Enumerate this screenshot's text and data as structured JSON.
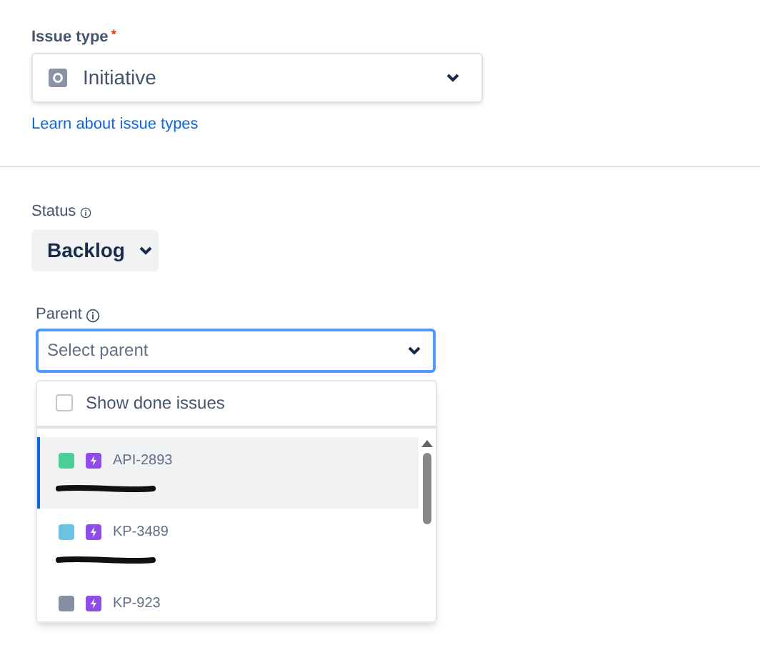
{
  "issue_type": {
    "label": "Issue type",
    "required_mark": "*",
    "value": "Initiative",
    "link": "Learn about issue types"
  },
  "status": {
    "label": "Status",
    "value": "Backlog"
  },
  "parent": {
    "label": "Parent",
    "placeholder": "Select parent",
    "show_done": {
      "label": "Show done issues",
      "checked": false
    },
    "options": [
      {
        "key": "API-2893",
        "color": "#4bce97",
        "selected": true
      },
      {
        "key": "KP-3489",
        "color": "#6cc3e0",
        "selected": false
      },
      {
        "key": "KP-923",
        "color": "#8590a2",
        "selected": false
      }
    ]
  }
}
